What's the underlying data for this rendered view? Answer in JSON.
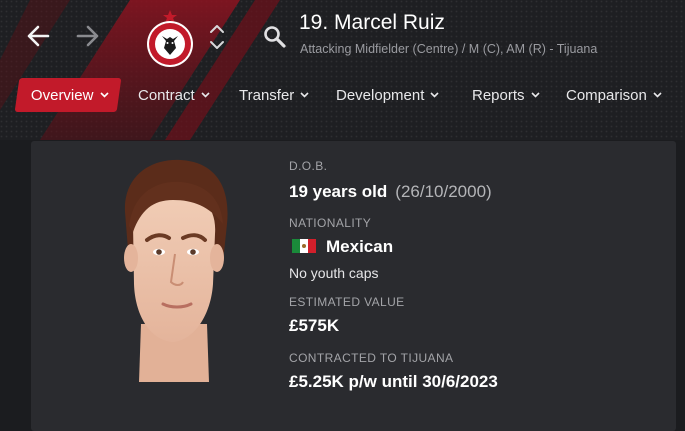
{
  "header": {
    "player_name": "19. Marcel Ruiz",
    "position_line": "Attacking Midfielder (Centre) / M (C), AM (R) - Tijuana",
    "club_crest": "club-tijuana-crest",
    "back_icon": "arrow-left-icon",
    "forward_icon": "arrow-right-icon",
    "search_icon": "search-icon"
  },
  "tabs": [
    {
      "label": "Overview",
      "active": true
    },
    {
      "label": "Contract",
      "active": false
    },
    {
      "label": "Transfer",
      "active": false
    },
    {
      "label": "Development",
      "active": false
    },
    {
      "label": "Reports",
      "active": false
    },
    {
      "label": "Comparison",
      "active": false
    }
  ],
  "profile": {
    "dob_label": "D.O.B.",
    "age": "19 years old",
    "dob": "(26/10/2000)",
    "nationality_label": "NATIONALITY",
    "nationality": "Mexican",
    "youth_caps": "No youth caps",
    "value_label": "ESTIMATED VALUE",
    "value": "£575K",
    "contract_label": "CONTRACTED TO TIJUANA",
    "contract": "£5.25K p/w until 30/6/2023"
  },
  "colors": {
    "accent": "#c21a2a",
    "background": "#1b1c1f",
    "card": "#2a2b2f"
  }
}
